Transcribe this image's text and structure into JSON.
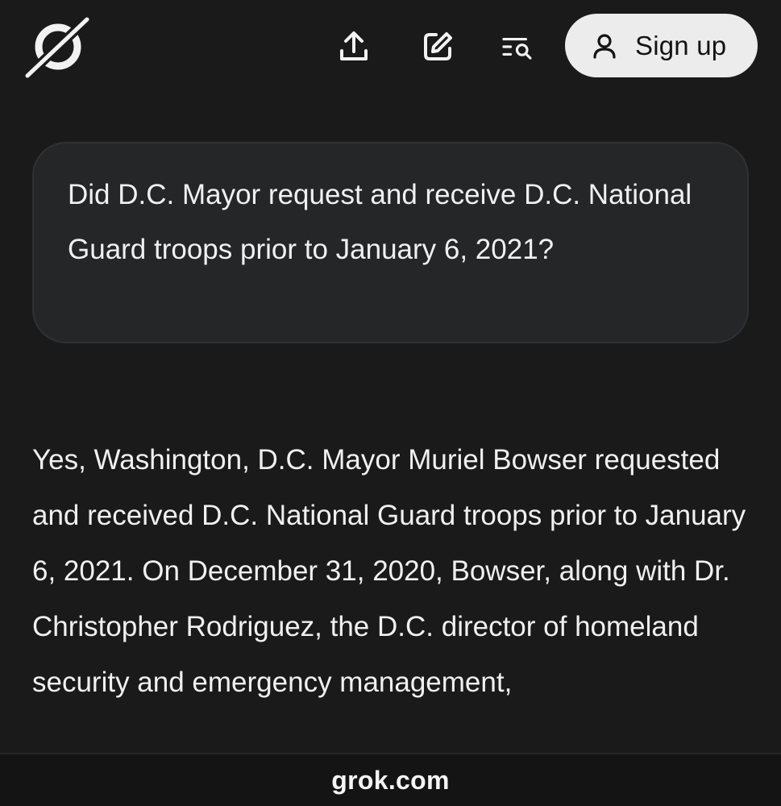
{
  "header": {
    "logo": "grok-logo",
    "actions": [
      {
        "icon": "upload-icon"
      },
      {
        "icon": "edit-icon"
      },
      {
        "icon": "search-history-icon"
      }
    ],
    "signup_label": "Sign up",
    "signup_icon": "user-icon"
  },
  "conversation": {
    "user_message": "Did D.C. Mayor request and receive D.C. National Guard troops prior to January 6, 2021?",
    "assistant_message": "Yes, Washington, D.C. Mayor Muriel Bowser requested and received D.C. National Guard troops prior to January 6, 2021. On December 31, 2020, Bowser, along with Dr. Christopher Rodriguez, the D.C. director of homeland security and emergency management,"
  },
  "browser": {
    "url": "grok.com"
  },
  "colors": {
    "background": "#1a1a1b",
    "bubble": "#242627",
    "signup_bg": "#ececec"
  }
}
